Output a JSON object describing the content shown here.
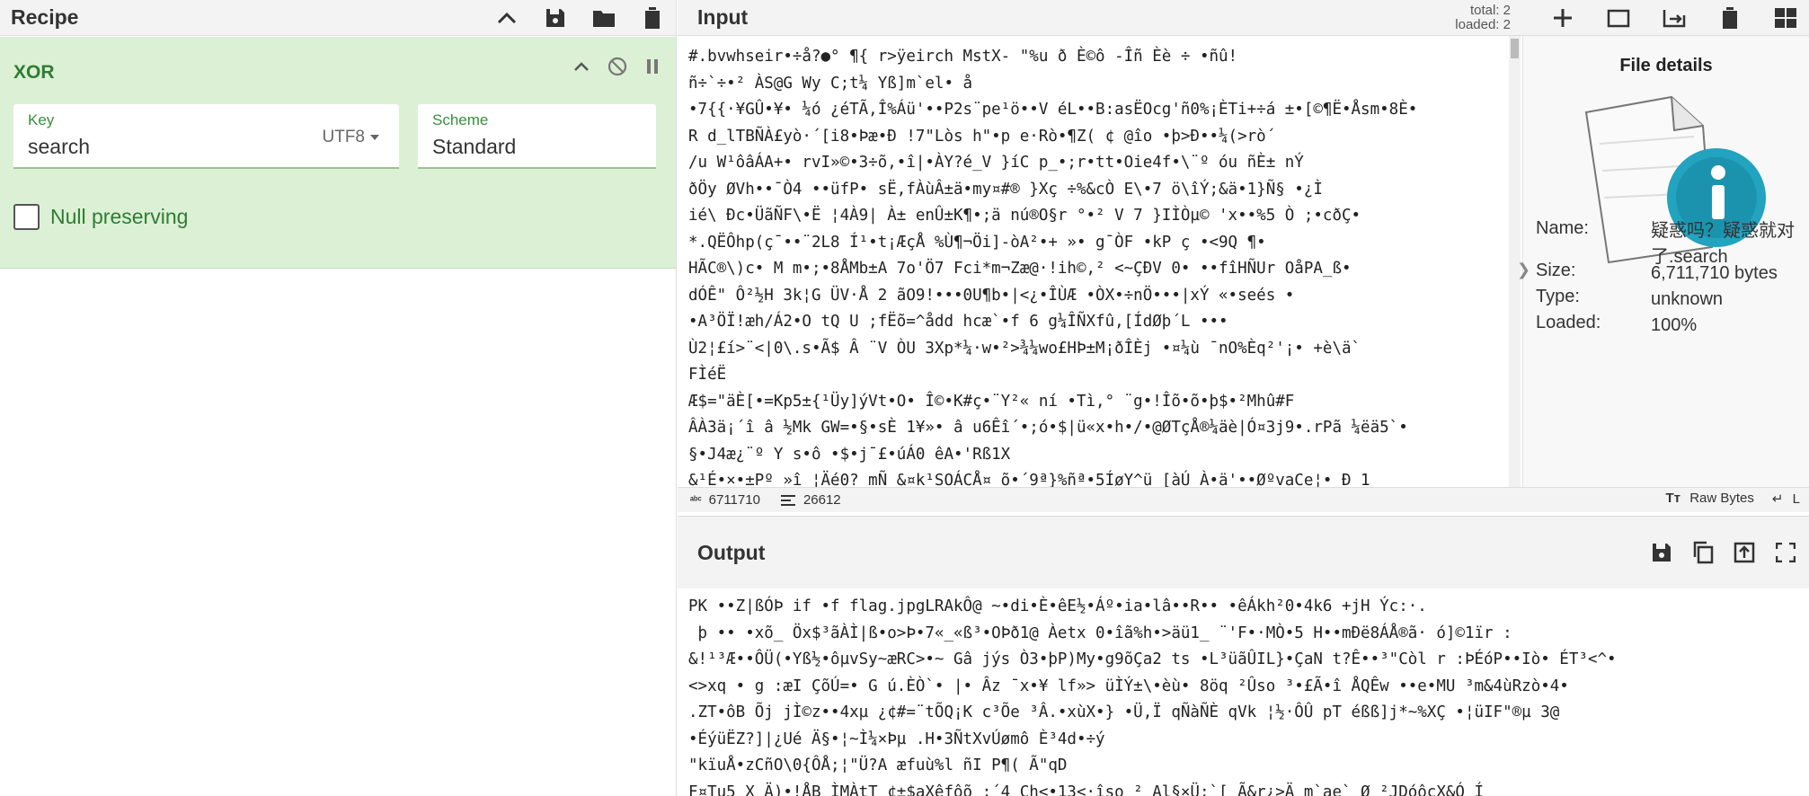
{
  "recipe": {
    "title": "Recipe",
    "operation": {
      "name": "XOR",
      "key_label": "Key",
      "key_value": "search",
      "key_encoding": "UTF8",
      "scheme_label": "Scheme",
      "scheme_value": "Standard",
      "null_preserving_label": "Null preserving"
    }
  },
  "input": {
    "title": "Input",
    "stats_total": "total: 2",
    "stats_loaded": "loaded: 2",
    "text": "#.bvwhseir•÷å?●° ¶{ r>ÿeirch MstX- \"%u ð È©ô -Îñ Èè ÷ •ñû!\nñ÷`÷•² ÀS@G Wy C;t¼ Yß]m`el• å\n•7{{·¥GÛ•¥• ¼ó ¿éTÃ,Î%Áü'••P2s¨pe¹ö••V éL••B:asËOcg'ñ0%¡ÈTi+÷á ±•[©¶Ë•Åsm•8È•\nR d_lTBÑÀ£yò·´[i8•Þæ•Ð !7\"Lòs h\"•p e·Rò•¶Z( ¢ @îo •þ>Ð••¼(>rò´\n/u W¹ôâÁA+• rvI»©•3÷õ,•î|•ÀY?é_V }íC p_•;r•tt•Oie4f•\\¨º óu ñÈ± nÝ\nðÖy ØVh••¯Ò4 ••üfP• sË,fÀùÂ±ä•my¤#® }Xç ÷%&cÒ E\\•7 ö\\îÝ;&ä•1}Ñ§ •¿Ì\nié\\ Ðc•ÜãÑF\\•Ë ¦4À9| À± enÛ±K¶•;ä nú®O§r °•² V 7 }IÌÒµ© 'x••%5 Ò ;•cðÇ•\n*.QËÔhp(ç¯••¨2L8 Í¹•t¡ÆçÅ %Ù¶¬Öi]-òA²•+ »• g¯ÒF •kP ç •<9Q ¶•\nHÃC®\\)c• M m•;•8ÅMb±A 7o'Ö7 Fci*m¬Zæ@·!ih©,² <~ÇÐV 0• ••fîHÑUr OåPA_ß•\ndÓÊ\" Ô²½H 3k¦G ÜV·Å 2 ãO9!•••0U¶b•|<¿•ÎÙÆ •ÒX•÷nÖ•••|xÝ «•seés •\n•A³ÖÏ!æh/Á2•O tQ U ;fËõ=^ådd hcæ`•f 6 g¼ÎÑXfû,[ÍdØþ´L •••\nÙ2¦£í>¨<|0\\.s•Ã$ Â ¨V ÒU 3Xp*¼·w•²>¾¼wo£HÞ±M¡ðÎÈj •¤¼ù ¯nO%Èq²'¡• +è\\ä`\nFÌéË\nÆ$=\"äÈ[•=Kp5±{¹Üy]ýVt•O• Î©•K#ç•¨Y²« ní •Tì,° ¨g•!Îõ•õ•þ$•²Mhû#F\nÂÀ3ä¡´î â ½Mk GW=•§•sÈ 1¥»• â u6Êî´•;ó•$|ü«x•h•/•@ØTçÅ®¼äè|Ó¤3j9•.rPã ¼ëä5`•\n§•J4æ¿¨º Y s•ô •$•j¯£•úÁ0 êA•'Rß1X\n&¹É•×•±Pº »î ¦Äé0? mÑ &¤k¹SOÁCÅ¤ õ•´9ª}%ñª•5ÍøY^ü [àÚ À•ä'••ØºvaCe¦• Ð 1"
  },
  "file_details": {
    "title": "File details",
    "name_label": "Name:",
    "name_value": "疑惑吗？疑惑就对了.search",
    "size_label": "Size:",
    "size_value": "6,711,710 bytes",
    "type_label": "Type:",
    "type_value": "unknown",
    "loaded_label": "Loaded:",
    "loaded_value": "100%"
  },
  "status": {
    "length": "6711710",
    "lines": "26612",
    "encoding_button": "Raw Bytes",
    "eol_button": "L"
  },
  "output": {
    "title": "Output",
    "text": "PK ••Z|ßÓÞ if •f flag.jpgLRAkÔ@ ~•di•È•êE½•Áº•ia•lâ••R•• •êÁkh²0•4k6 +jH Ýc:·.\n þ •• •xõ_ Öx$³ãÀÌ|ß•o>Þ•7«_«ß³•OÞð1@ Àetx 0•îã%h•>äü1_ ¨'F•·MÒ•5 H••mÐë8ÁÅ®ã· ó]©1ïr :\n&!¹³Æ••ÔÜ(•Yß½•ôµvSy~æRC>•~ Gâ jýs Ò3•þP)My•g9õÇa2 ts •L³üãÛIL}•ÇaN t?Ê••³\"Còl r :ÞÉóP••Iò• ÉT³<^•\n<>xq • g :æI ÇõÚ=• G ú.ÈÒ`• |• Âz ¯x•¥ lf»> üÌÝ±\\•èù• 8öq ²Ûso ³•£Ã•î ÅQÊw ••e•MU ³m&4ùRzò•4•\n.ZT•ôB Õj jÌ©z••4xµ ¿¢#=¨tÕQ¡K c³Õe ³Â.•xùX•} •Ü,Ï qÑàÑÈ qVk ¦½·ÔÛ pT éßß]j*~%XÇ •¦üIF\"®µ 3@\n•ÉýüËZ?]|¿Ué Ä§•¦~Ì¼×Þµ .H•3ÑtXvÚømô È³4d•÷ý\n\"kïuÅ•zCñO\\0{ÔÅ;¦\"Ü?A æfuù%l ñI P¶( Ã\"qD\nF¤Tu5 X Ä)•!ÅB ÌMÀtT ¢±$aXêfôõ ;´4 Ch<•13<·îso ² Al§×Ü:`[ Ã&r¿>Ä m`ae` Ø ²JDóôçX&Ó Í "
  }
}
